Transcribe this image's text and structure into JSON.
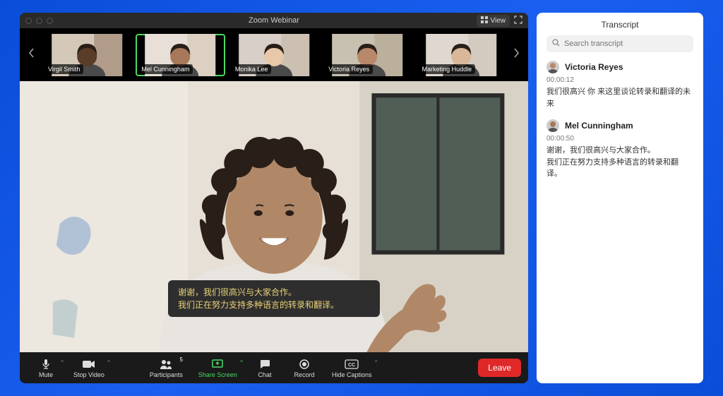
{
  "window": {
    "title": "Zoom Webinar",
    "view_label": "View"
  },
  "gallery": {
    "participants": [
      {
        "name": "Virgil Smith",
        "bg1": "#d4c8b8",
        "bg2": "#7a5a44",
        "skin": "#5a3d28"
      },
      {
        "name": "Mel Cunningham",
        "bg1": "#e8e0d8",
        "bg2": "#c8b8a0",
        "skin": "#a8785a",
        "active": true
      },
      {
        "name": "Monika Lee",
        "bg1": "#d8d0c8",
        "bg2": "#b8a890",
        "skin": "#e8c8a8"
      },
      {
        "name": "Victoria Reyes",
        "bg1": "#c8c0b0",
        "bg2": "#a89880",
        "skin": "#b8886a"
      },
      {
        "name": "Marketing Huddle",
        "bg1": "#e0d8d0",
        "bg2": "#c0b8a8",
        "skin": "#d8b898"
      }
    ]
  },
  "captions": {
    "line1": "谢谢，我们很高兴与大家合作。",
    "line2": "我们正在努力支持多种语言的转录和翻译。"
  },
  "toolbar": {
    "mute_label": "Mute",
    "stop_video_label": "Stop Video",
    "participants_label": "Participants",
    "participants_count": "5",
    "share_screen_label": "Share Screen",
    "chat_label": "Chat",
    "record_label": "Record",
    "hide_captions_label": "Hide Captions",
    "hide_captions_badge": "CC",
    "leave_label": "Leave"
  },
  "transcript": {
    "title": "Transcript",
    "search_placeholder": "Search transcript",
    "entries": [
      {
        "speaker": "Victoria Reyes",
        "timestamp": "00:00:12",
        "text": "我们很高兴 你 来这里谈论转录和翻译的未来",
        "skin": "#b8886a"
      },
      {
        "speaker": "Mel Cunningham",
        "timestamp": "00:00:50",
        "text": "谢谢，我们很高兴与大家合作。\n我们正在努力支持多种语言的转录和翻译。",
        "skin": "#a8785a"
      }
    ]
  }
}
